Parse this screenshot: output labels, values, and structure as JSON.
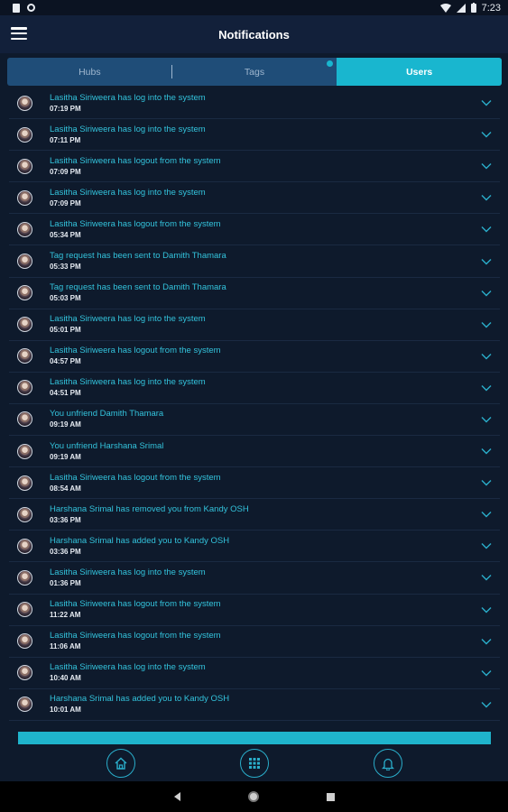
{
  "status_bar": {
    "time": "7:23"
  },
  "app_bar": {
    "title": "Notifications"
  },
  "tabs": [
    {
      "label": "Hubs",
      "active": false
    },
    {
      "label": "Tags",
      "active": false,
      "badge": true
    },
    {
      "label": "Users",
      "active": true
    }
  ],
  "notifications": [
    {
      "message": "Lasitha Siriweera has log into the system",
      "time": "07:19 PM"
    },
    {
      "message": "Lasitha Siriweera has log into the system",
      "time": "07:11 PM"
    },
    {
      "message": "Lasitha Siriweera has logout from the system",
      "time": "07:09 PM"
    },
    {
      "message": "Lasitha Siriweera has log into the system",
      "time": "07:09 PM"
    },
    {
      "message": "Lasitha Siriweera has logout from the system",
      "time": "05:34 PM"
    },
    {
      "message": "Tag request has been sent to Damith Thamara",
      "time": "05:33 PM"
    },
    {
      "message": "Tag request has been sent to Damith Thamara",
      "time": "05:03 PM"
    },
    {
      "message": "Lasitha Siriweera has log into the system",
      "time": "05:01 PM"
    },
    {
      "message": "Lasitha Siriweera has logout from the system",
      "time": "04:57 PM"
    },
    {
      "message": "Lasitha Siriweera has log into the system",
      "time": "04:51 PM"
    },
    {
      "message": "You unfriend Damith Thamara",
      "time": "09:19 AM"
    },
    {
      "message": "You unfriend Harshana Srimal",
      "time": "09:19 AM"
    },
    {
      "message": "Lasitha Siriweera has logout from the system",
      "time": "08:54 AM"
    },
    {
      "message": "Harshana Srimal has removed you from Kandy OSH",
      "time": "03:36 PM"
    },
    {
      "message": "Harshana Srimal has added you to Kandy OSH",
      "time": "03:36 PM"
    },
    {
      "message": "Lasitha Siriweera has log into the system",
      "time": "01:36 PM"
    },
    {
      "message": "Lasitha Siriweera has logout from the system",
      "time": "11:22 AM"
    },
    {
      "message": "Lasitha Siriweera has logout from the system",
      "time": "11:06 AM"
    },
    {
      "message": "Lasitha Siriweera has log into the system",
      "time": "10:40 AM"
    },
    {
      "message": "Harshana Srimal has added you to Kandy OSH",
      "time": "10:01 AM"
    }
  ],
  "bottom_nav": [
    {
      "icon": "home-icon"
    },
    {
      "icon": "grid-icon"
    },
    {
      "icon": "bell-icon"
    }
  ],
  "colors": {
    "accent": "#19b6cf",
    "message_text": "#33c3dc",
    "background": "#0e1a2c"
  }
}
